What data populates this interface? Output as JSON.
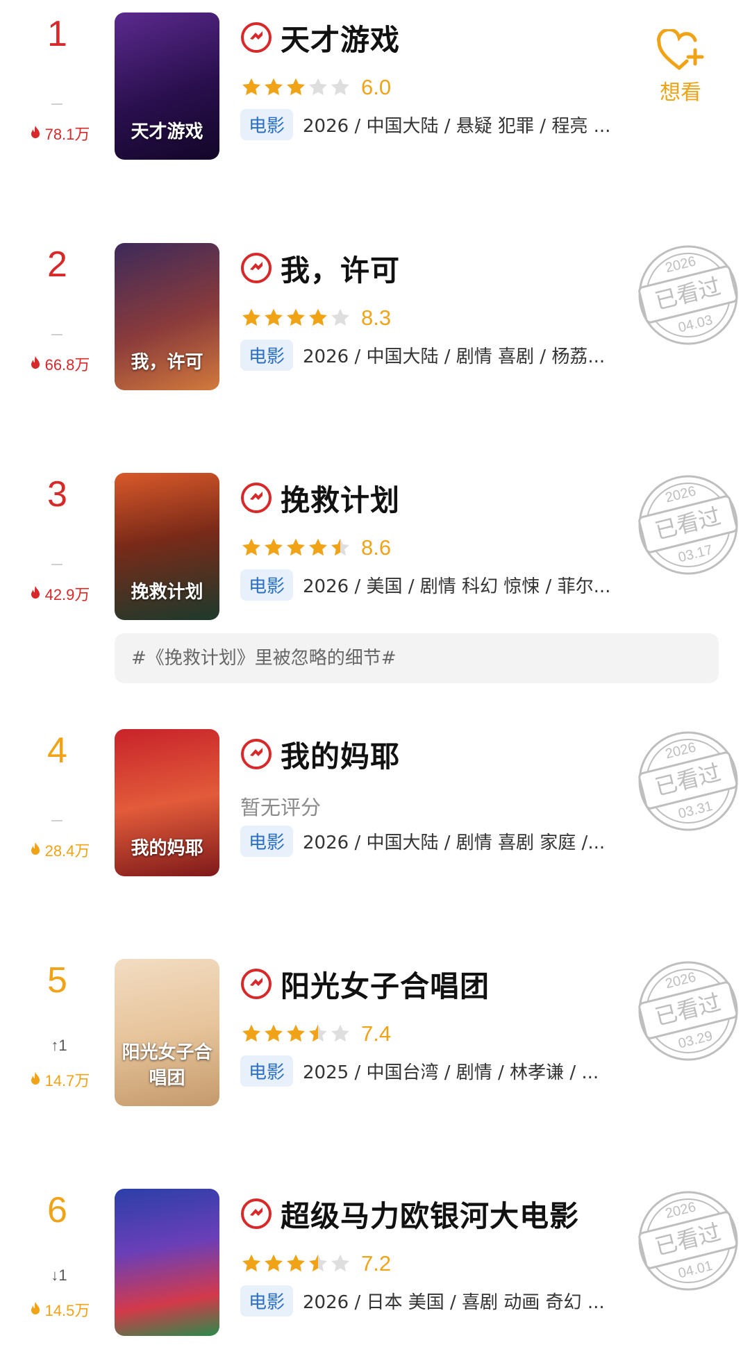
{
  "items": [
    {
      "rank": "1",
      "change": "",
      "heat": "78.1万",
      "color": "red",
      "title": "天才游戏",
      "stars": 3,
      "score": "6.0",
      "no_rating": "",
      "type": "电影",
      "meta": "2026 / 中国大陆 / 悬疑 犯罪 / 程亮 ...",
      "poster_text": "天才游戏",
      "poster_bg": "linear-gradient(160deg,#5b2a8e 0%,#2a0f4e 55%,#120628 100%)",
      "action": "wish",
      "wish_label": "想看"
    },
    {
      "rank": "2",
      "change": "",
      "heat": "66.8万",
      "color": "red",
      "title": "我，许可",
      "stars": 4,
      "score": "8.3",
      "no_rating": "",
      "type": "电影",
      "meta": "2026 / 中国大陆 / 剧情 喜剧 / 杨荔...",
      "poster_text": "我，许可",
      "poster_bg": "linear-gradient(160deg,#3d2a5a 0%,#8a3b3b 55%,#d27a3c 100%)",
      "action": "stamp",
      "stamp_year": "2026",
      "stamp_label": "已看过",
      "stamp_date": "04.03"
    },
    {
      "rank": "3",
      "change": "",
      "heat": "42.9万",
      "color": "red",
      "title": "挽救计划",
      "stars": 4.5,
      "score": "8.6",
      "no_rating": "",
      "type": "电影",
      "meta": "2026 / 美国 / 剧情 科幻 惊悚 / 菲尔...",
      "poster_text": "挽救计划",
      "poster_bg": "linear-gradient(170deg,#d9592a 0%,#7a2a18 45%,#1d3a2c 100%)",
      "action": "stamp",
      "stamp_year": "2026",
      "stamp_label": "已看过",
      "stamp_date": "03.17"
    },
    {
      "rank": "4",
      "change": "",
      "heat": "28.4万",
      "color": "orange",
      "title": "我的妈耶",
      "stars": 0,
      "score": "",
      "no_rating": "暂无评分",
      "type": "电影",
      "meta": "2026 / 中国大陆 / 剧情 喜剧 家庭 /...",
      "poster_text": "我的妈耶",
      "poster_bg": "linear-gradient(170deg,#c8232a 0%,#e25b3a 50%,#7e1a1a 100%)",
      "action": "stamp",
      "stamp_year": "2026",
      "stamp_label": "已看过",
      "stamp_date": "03.31"
    },
    {
      "rank": "5",
      "change": "↑1",
      "heat": "14.7万",
      "color": "orange",
      "title": "阳光女子合唱团",
      "stars": 3.5,
      "score": "7.4",
      "no_rating": "",
      "type": "电影",
      "meta": "2025 / 中国台湾 / 剧情 / 林孝谦 / ...",
      "poster_text": "阳光女子合唱团",
      "poster_bg": "linear-gradient(170deg,#f2dcc2 0%,#e7c49b 50%,#c49a6c 100%)",
      "action": "stamp",
      "stamp_year": "2026",
      "stamp_label": "已看过",
      "stamp_date": "03.29"
    },
    {
      "rank": "6",
      "change": "↓1",
      "heat": "14.5万",
      "color": "orange",
      "title": "超级马力欧银河大电影",
      "stars": 3.5,
      "score": "7.2",
      "no_rating": "",
      "type": "电影",
      "meta": "2026 / 日本 美国 / 喜剧 动画 奇幻 ...",
      "poster_text": "",
      "poster_bg": "linear-gradient(170deg,#2b3fa8 0%,#6a3fb8 40%,#d33a4a 75%,#2a8a4a 100%)",
      "action": "stamp",
      "stamp_year": "2026",
      "stamp_label": "已看过",
      "stamp_date": "04.01"
    }
  ],
  "topic": "#《挽救计划》里被忽略的细节#",
  "colors": {
    "red": "#d7282a",
    "orange": "#f0a316",
    "badge_bg": "#e8f1fb",
    "badge_text": "#2b6fc2"
  }
}
